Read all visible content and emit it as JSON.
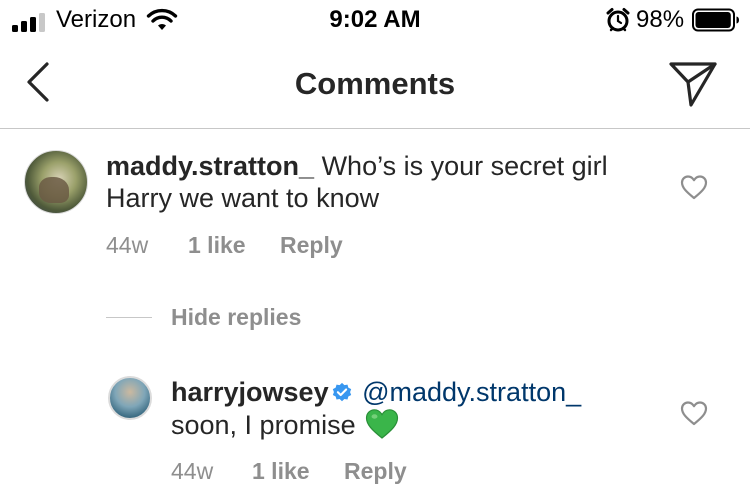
{
  "status_bar": {
    "carrier": "Verizon",
    "time": "9:02 AM",
    "battery_percent": "98%",
    "signal_bars": 3,
    "signal_bars_max": 4,
    "battery_level": 0.98,
    "icons": [
      "signal-icon",
      "wifi-icon",
      "alarm-icon",
      "battery-icon"
    ]
  },
  "nav": {
    "title": "Comments",
    "back_icon": "chevron-left-icon",
    "share_icon": "paper-plane-icon"
  },
  "comments": [
    {
      "username": "maddy.stratton_",
      "text": "Who’s is your secret girl Harry we want to know",
      "age": "44w",
      "likes": "1 like",
      "reply_label": "Reply",
      "hide_replies_label": "Hide replies",
      "replies": [
        {
          "username": "harryjowsey",
          "verified": true,
          "mention": "@maddy.stratton_",
          "text": "soon, I promise",
          "emoji": "green-heart-emoji",
          "age": "44w",
          "likes": "1 like",
          "reply_label": "Reply"
        }
      ]
    }
  ],
  "colors": {
    "text": "#262626",
    "meta": "#8e8e8e",
    "mention": "#00376b",
    "verified": "#3897f0",
    "divider": "#c7c7c7",
    "green_heart": "#3ab54a"
  }
}
